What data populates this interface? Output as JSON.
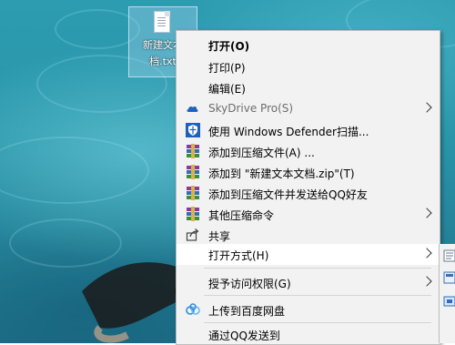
{
  "desktop_file": {
    "name_line1": "新建文本",
    "name_line2": "档.txt"
  },
  "context_menu": {
    "items": [
      {
        "label": "打开(O)",
        "bold": true
      },
      {
        "label": "打印(P)"
      },
      {
        "label": "编辑(E)"
      },
      {
        "label": "SkyDrive Pro(S)",
        "disabled": true,
        "icon": "cloud-icon",
        "submenu": true
      },
      {
        "label": "使用 Windows Defender扫描...",
        "icon": "defender-shield-icon"
      },
      {
        "label": "添加到压缩文件(A) ...",
        "icon": "winrar-icon"
      },
      {
        "label": "添加到 \"新建文本文档.zip\"(T)",
        "icon": "winrar-icon"
      },
      {
        "label": "添加到压缩文件并发送给QQ好友",
        "icon": "winrar-icon"
      },
      {
        "label": "其他压缩命令",
        "icon": "winrar-icon",
        "submenu": true
      },
      {
        "label": "共享",
        "icon": "share-icon"
      },
      {
        "label": "打开方式(H)",
        "submenu": true,
        "highlighted": true
      },
      {
        "label": "授予访问权限(G)",
        "submenu": true
      },
      {
        "label": "上传到百度网盘",
        "icon": "baidu-netdisk-icon"
      },
      {
        "label": "通过QQ发送到"
      }
    ]
  },
  "colors": {
    "menu_bg": "#f2f2f2",
    "highlight": "#ffffff",
    "accent_blue": "#1f5fbf"
  }
}
